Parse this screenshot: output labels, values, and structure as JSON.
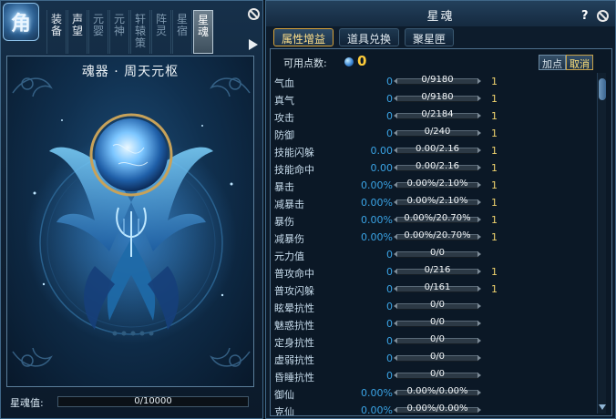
{
  "left": {
    "badge_char": "角",
    "tabs": [
      {
        "label": "装备",
        "state": "enabled"
      },
      {
        "label": "声望",
        "state": "enabled"
      },
      {
        "label": "元婴",
        "state": "disabled"
      },
      {
        "label": "元神",
        "state": "disabled"
      },
      {
        "label": "轩辕策",
        "state": "disabled"
      },
      {
        "label": "阵灵",
        "state": "disabled"
      },
      {
        "label": "星宿",
        "state": "disabled"
      },
      {
        "label": "星魂",
        "state": "active"
      }
    ],
    "artifact_name": "魂器 · 周天元枢",
    "soul_label": "星魂值:",
    "soul_value": "0/10000",
    "soul_fill": 0
  },
  "right": {
    "title": "星魂",
    "help": "?",
    "tabs": [
      "属性增益",
      "道具兑换",
      "聚星匣"
    ],
    "points_label": "可用点数:",
    "points_value": "0",
    "add_label": "加点",
    "cancel_label": "取消",
    "attributes": [
      {
        "name": "气血",
        "value": "0",
        "max": "0/9180",
        "level": "1"
      },
      {
        "name": "真气",
        "value": "0",
        "max": "0/9180",
        "level": "1"
      },
      {
        "name": "攻击",
        "value": "0",
        "max": "0/2184",
        "level": "1"
      },
      {
        "name": "防御",
        "value": "0",
        "max": "0/240",
        "level": "1"
      },
      {
        "name": "技能闪躲",
        "value": "0.00",
        "max": "0.00/2.16",
        "level": "1"
      },
      {
        "name": "技能命中",
        "value": "0.00",
        "max": "0.00/2.16",
        "level": "1"
      },
      {
        "name": "暴击",
        "value": "0.00%",
        "max": "0.00%/2.10%",
        "level": "1"
      },
      {
        "name": "减暴击",
        "value": "0.00%",
        "max": "0.00%/2.10%",
        "level": "1"
      },
      {
        "name": "暴伤",
        "value": "0.00%",
        "max": "0.00%/20.70%",
        "level": "1"
      },
      {
        "name": "减暴伤",
        "value": "0.00%",
        "max": "0.00%/20.70%",
        "level": "1"
      },
      {
        "name": "元力值",
        "value": "0",
        "max": "0/0",
        "level": ""
      },
      {
        "name": "普攻命中",
        "value": "0",
        "max": "0/216",
        "level": "1"
      },
      {
        "name": "普攻闪躲",
        "value": "0",
        "max": "0/161",
        "level": "1"
      },
      {
        "name": "眩晕抗性",
        "value": "0",
        "max": "0/0",
        "level": ""
      },
      {
        "name": "魅惑抗性",
        "value": "0",
        "max": "0/0",
        "level": ""
      },
      {
        "name": "定身抗性",
        "value": "0",
        "max": "0/0",
        "level": ""
      },
      {
        "name": "虚弱抗性",
        "value": "0",
        "max": "0/0",
        "level": ""
      },
      {
        "name": "昏睡抗性",
        "value": "0",
        "max": "0/0",
        "level": ""
      },
      {
        "name": "御仙",
        "value": "0.00%",
        "max": "0.00%/0.00%",
        "level": ""
      },
      {
        "name": "克仙",
        "value": "0.00%",
        "max": "0.00%/0.00%",
        "level": ""
      }
    ]
  },
  "colors": {
    "accent_gold": "#ffcc3a",
    "value_blue": "#3aa4e6",
    "level_gold": "#f0d36e"
  }
}
